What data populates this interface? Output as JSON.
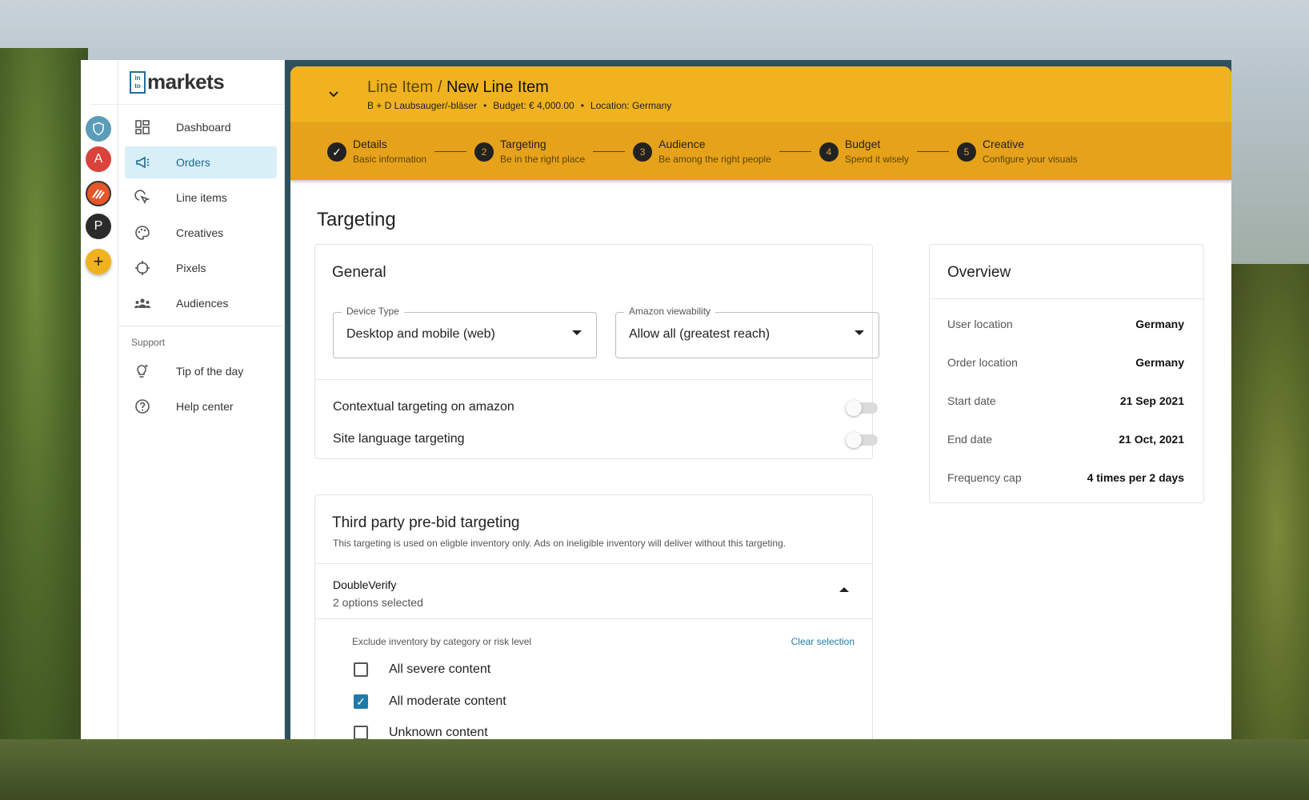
{
  "logo": {
    "box_line1": "in",
    "box_line2": "to",
    "text": "markets"
  },
  "rail": {
    "avatar_a": "A",
    "avatar_p": "P",
    "add": "+"
  },
  "nav": {
    "items": [
      {
        "label": "Dashboard",
        "icon": "dashboard-icon"
      },
      {
        "label": "Orders",
        "icon": "megaphone-icon"
      },
      {
        "label": "Line items",
        "icon": "cursor-click-icon"
      },
      {
        "label": "Creatives",
        "icon": "palette-icon"
      },
      {
        "label": "Pixels",
        "icon": "crosshair-icon"
      },
      {
        "label": "Audiences",
        "icon": "people-icon"
      }
    ],
    "support_label": "Support",
    "support_items": [
      {
        "label": "Tip of the day",
        "icon": "lightbulb-icon"
      },
      {
        "label": "Help center",
        "icon": "help-icon"
      }
    ]
  },
  "header": {
    "crumb_parent": "Line Item /",
    "crumb_current": "New Line Item",
    "meta_product": "B + D Laubsauger/-bläser",
    "meta_budget": "Budget: € 4,000.00",
    "meta_location": "Location: Germany",
    "bullet": "•"
  },
  "steps": [
    {
      "num": "✓",
      "title": "Details",
      "sub": "Basic information"
    },
    {
      "num": "2",
      "title": "Targeting",
      "sub": "Be in the right place"
    },
    {
      "num": "3",
      "title": "Audience",
      "sub": "Be among the right people"
    },
    {
      "num": "4",
      "title": "Budget",
      "sub": "Spend it wisely"
    },
    {
      "num": "5",
      "title": "Creative",
      "sub": "Configure your visuals"
    }
  ],
  "page_title": "Targeting",
  "general": {
    "title": "General",
    "device_label": "Device Type",
    "device_value": "Desktop and mobile (web)",
    "viewability_label": "Amazon viewability",
    "viewability_value": "Allow all (greatest reach)",
    "contextual_label": "Contextual targeting on amazon",
    "language_label": "Site language targeting"
  },
  "third_party": {
    "title": "Third party pre-bid targeting",
    "subtitle": "This targeting is used on eligble inventory only. Ads on ineligible inventory will deliver without this targeting.",
    "provider": "DoubleVerify",
    "selected": "2 options selected",
    "exclude_label": "Exclude inventory by category or risk level",
    "clear_label": "Clear selection",
    "options": [
      {
        "label": "All severe content",
        "checked": false
      },
      {
        "label": "All moderate content",
        "checked": true
      },
      {
        "label": "Unknown content",
        "checked": false
      }
    ]
  },
  "overview": {
    "title": "Overview",
    "rows": [
      {
        "key": "User location",
        "value": "Germany"
      },
      {
        "key": "Order location",
        "value": "Germany"
      },
      {
        "key": "Start date",
        "value": "21 Sep 2021"
      },
      {
        "key": "End date",
        "value": "21 Oct, 2021"
      },
      {
        "key": "Frequency cap",
        "value": "4 times per 2 days"
      }
    ]
  },
  "colors": {
    "accent": "#f0b21e",
    "active_nav": "#d8eff8",
    "brand": "#1e6f9a"
  }
}
